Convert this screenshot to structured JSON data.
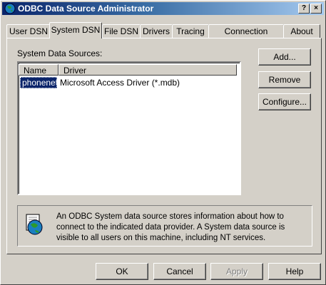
{
  "window": {
    "title": "ODBC Data Source Administrator",
    "help_button": "?",
    "close_button": "×",
    "accent": "#0a246a"
  },
  "tabs": [
    {
      "label": "User DSN"
    },
    {
      "label": "System DSN"
    },
    {
      "label": "File DSN"
    },
    {
      "label": "Drivers"
    },
    {
      "label": "Tracing"
    },
    {
      "label": "Connection Pooling"
    },
    {
      "label": "About"
    }
  ],
  "active_tab": "System DSN",
  "panel": {
    "list_label": "System Data Sources:",
    "columns": [
      "Name",
      "Driver"
    ],
    "rows": [
      {
        "name": "phonenet",
        "driver": "Microsoft Access Driver (*.mdb)"
      }
    ],
    "buttons": {
      "add": "Add...",
      "remove": "Remove",
      "configure": "Configure..."
    },
    "info_text": "An ODBC System data source stores information about how to connect to the indicated data provider.   A System data source is visible to all users on this machine, including NT services.",
    "info_icon": "globe-database-icon"
  },
  "footer": {
    "ok": "OK",
    "cancel": "Cancel",
    "apply": "Apply",
    "help": "Help"
  }
}
